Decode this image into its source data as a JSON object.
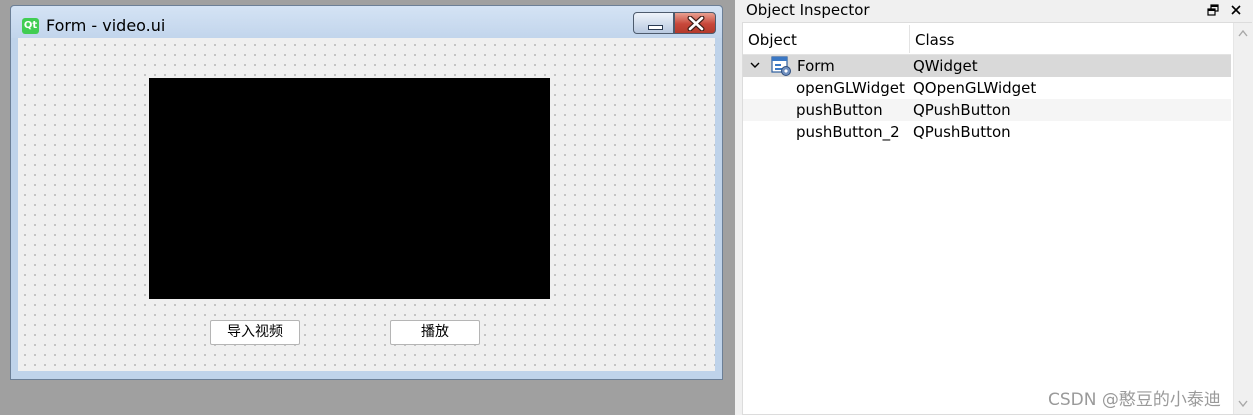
{
  "form_window": {
    "title": "Form - video.ui",
    "icon_label": "Qt",
    "icons": {
      "app": "qt-logo-icon",
      "minimize": "minimize-icon",
      "close": "close-icon"
    },
    "buttons": {
      "import_video": "导入视频",
      "play": "播放"
    }
  },
  "object_inspector": {
    "title": "Object Inspector",
    "icons": {
      "float": "float-window-icon",
      "close": "close-icon",
      "expand": "chevron-down-icon",
      "form": "form-widget-icon"
    },
    "columns": {
      "object": "Object",
      "class": "Class"
    },
    "rows": [
      {
        "object": "Form",
        "class": "QWidget"
      },
      {
        "object": "openGLWidget",
        "class": "QOpenGLWidget"
      },
      {
        "object": "pushButton",
        "class": "QPushButton"
      },
      {
        "object": "pushButton_2",
        "class": "QPushButton"
      }
    ]
  },
  "watermark": "CSDN @憨豆的小泰迪",
  "colors": {
    "title_bar": "#c9dcf0",
    "close_button": "#c7473a",
    "qt_green": "#41cd52",
    "selected_row": "#d9d9d9"
  }
}
